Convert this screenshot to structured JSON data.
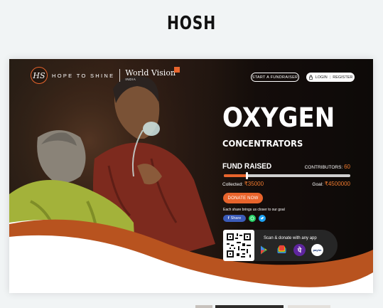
{
  "page": {
    "heading": "HOSH"
  },
  "site": {
    "logo_mark": "HS",
    "tagline": "HOPE TO SHINE",
    "partner_name": "World Vision",
    "partner_sub": "INDIA"
  },
  "nav": {
    "fundraiser_label": "START A FUNDRAISER",
    "login_label": "LOGIN",
    "register_label": "REGISTER",
    "separator": "|"
  },
  "campaign": {
    "title": "OXYGEN",
    "subtitle": "CONCENTRATORS",
    "fund_label": "FUND RAISED",
    "contributors_label": "CONTRIBUTORS:",
    "contributors_count": "60",
    "collected_label": "Collected:",
    "collected_value": "₹35000",
    "goal_label": "Goal:",
    "goal_value": "₹4500000",
    "progress_fraction": 0.18,
    "donate_label": "DONATE NOW",
    "share_note": "Each share brings us closer to our goal",
    "share_label": "Share"
  },
  "payment": {
    "scan_text": "Scan & donate with any app",
    "apps": [
      "google-play-icon",
      "google-pay-icon",
      "phonepe-icon",
      "paytm-icon"
    ],
    "paytm_label": "paytm"
  },
  "colors": {
    "accent": "#e8642c",
    "dark": "#111111",
    "share_blue": "#3b5bb8",
    "whatsapp": "#25d366",
    "twitter": "#1da1f2"
  }
}
